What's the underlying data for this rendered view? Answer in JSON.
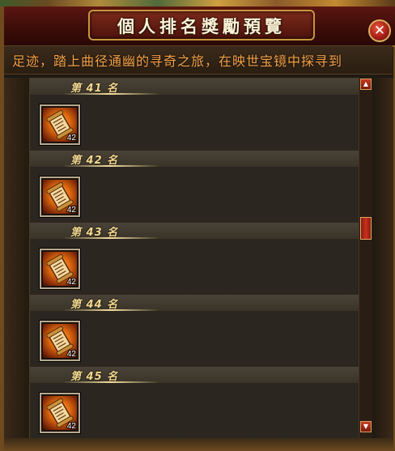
{
  "window": {
    "title": "個人排名獎勵預覽",
    "close_symbol": "✕"
  },
  "marquee": {
    "text": "足迹，踏上曲径通幽的寻奇之旅，在映世宝镜中探寻到"
  },
  "rewards": [
    {
      "rank_label": "第 41 名",
      "item_icon": "scroll-icon",
      "count": "42"
    },
    {
      "rank_label": "第 42 名",
      "item_icon": "scroll-icon",
      "count": "42"
    },
    {
      "rank_label": "第 43 名",
      "item_icon": "scroll-icon",
      "count": "42"
    },
    {
      "rank_label": "第 44 名",
      "item_icon": "scroll-icon",
      "count": "42"
    },
    {
      "rank_label": "第 45 名",
      "item_icon": "scroll-icon",
      "count": "42"
    }
  ],
  "scrollbar": {
    "up_symbol": "▲",
    "down_symbol": "▼"
  },
  "colors": {
    "title_text": "#fff4d8",
    "marquee_text": "#f6a248",
    "rank_text": "#f4d890",
    "accent_red": "#a8201a"
  }
}
